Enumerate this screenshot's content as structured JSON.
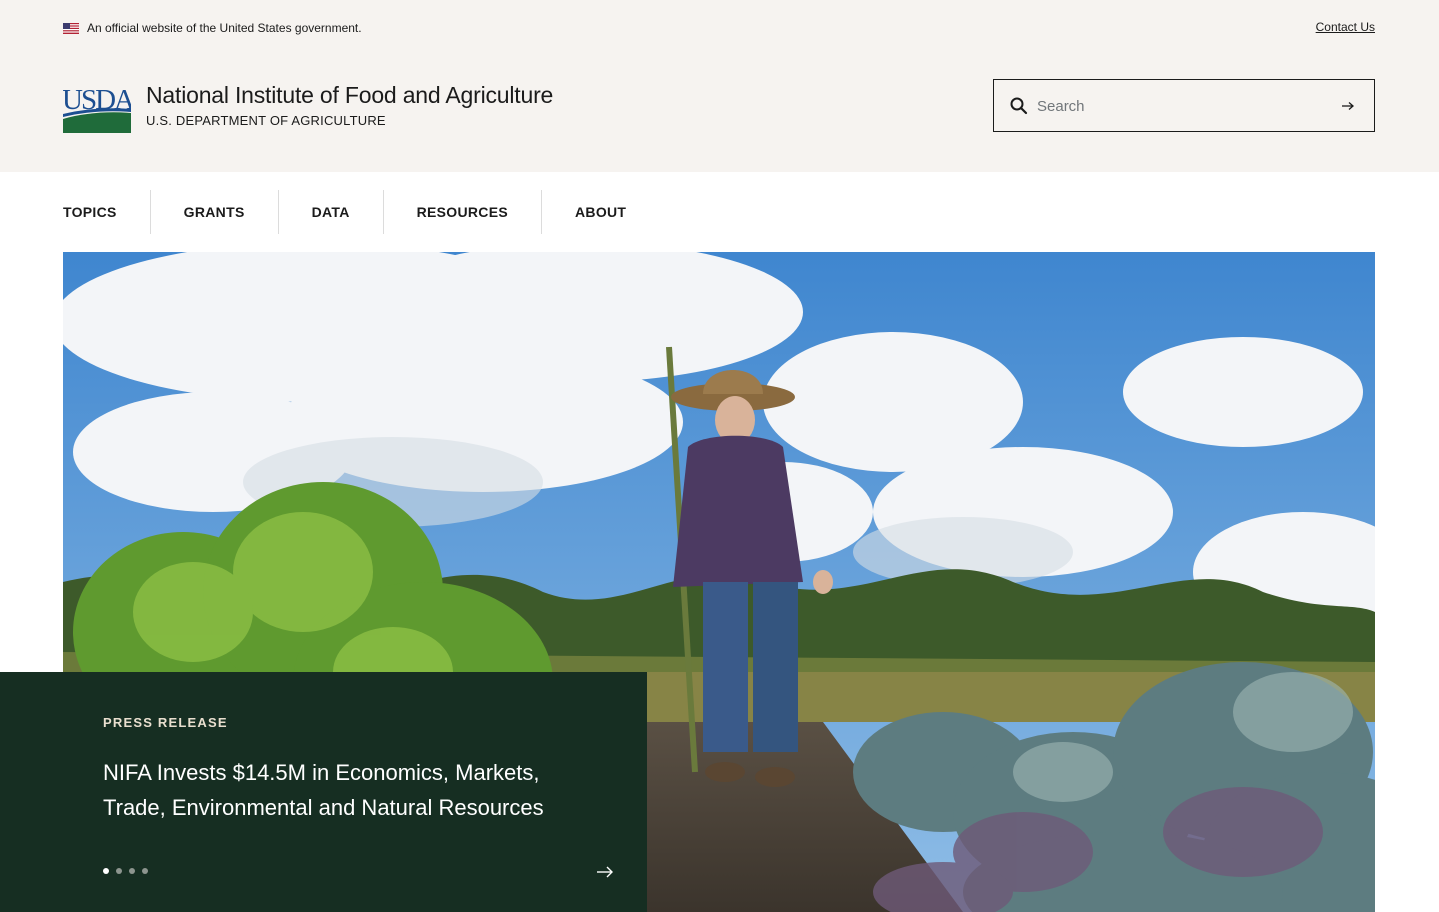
{
  "banner": {
    "official_text": "An official website of the United States government.",
    "contact_link": "Contact Us"
  },
  "header": {
    "logo_text": "USDA",
    "agency_name": "National Institute of Food and Agriculture",
    "department": "U.S. DEPARTMENT OF AGRICULTURE"
  },
  "search": {
    "placeholder": "Search",
    "value": ""
  },
  "nav": {
    "items": [
      "TOPICS",
      "GRANTS",
      "DATA",
      "RESOURCES",
      "ABOUT"
    ]
  },
  "hero": {
    "kicker": "PRESS RELEASE",
    "title": "NIFA Invests $14.5M in Economics, Markets, Trade, Environmental and Natural Resources",
    "slide_count": 4,
    "active_slide": 1
  },
  "colors": {
    "top_background": "#f6f3f0",
    "feature_background": "#162e22",
    "usda_blue": "#1d4f91",
    "usda_green": "#1f6b3a",
    "kicker": "#e9dfcf"
  },
  "icons": {
    "flag": "us-flag-icon",
    "search": "search-icon",
    "submit": "arrow-right-icon",
    "next": "arrow-right-icon"
  }
}
